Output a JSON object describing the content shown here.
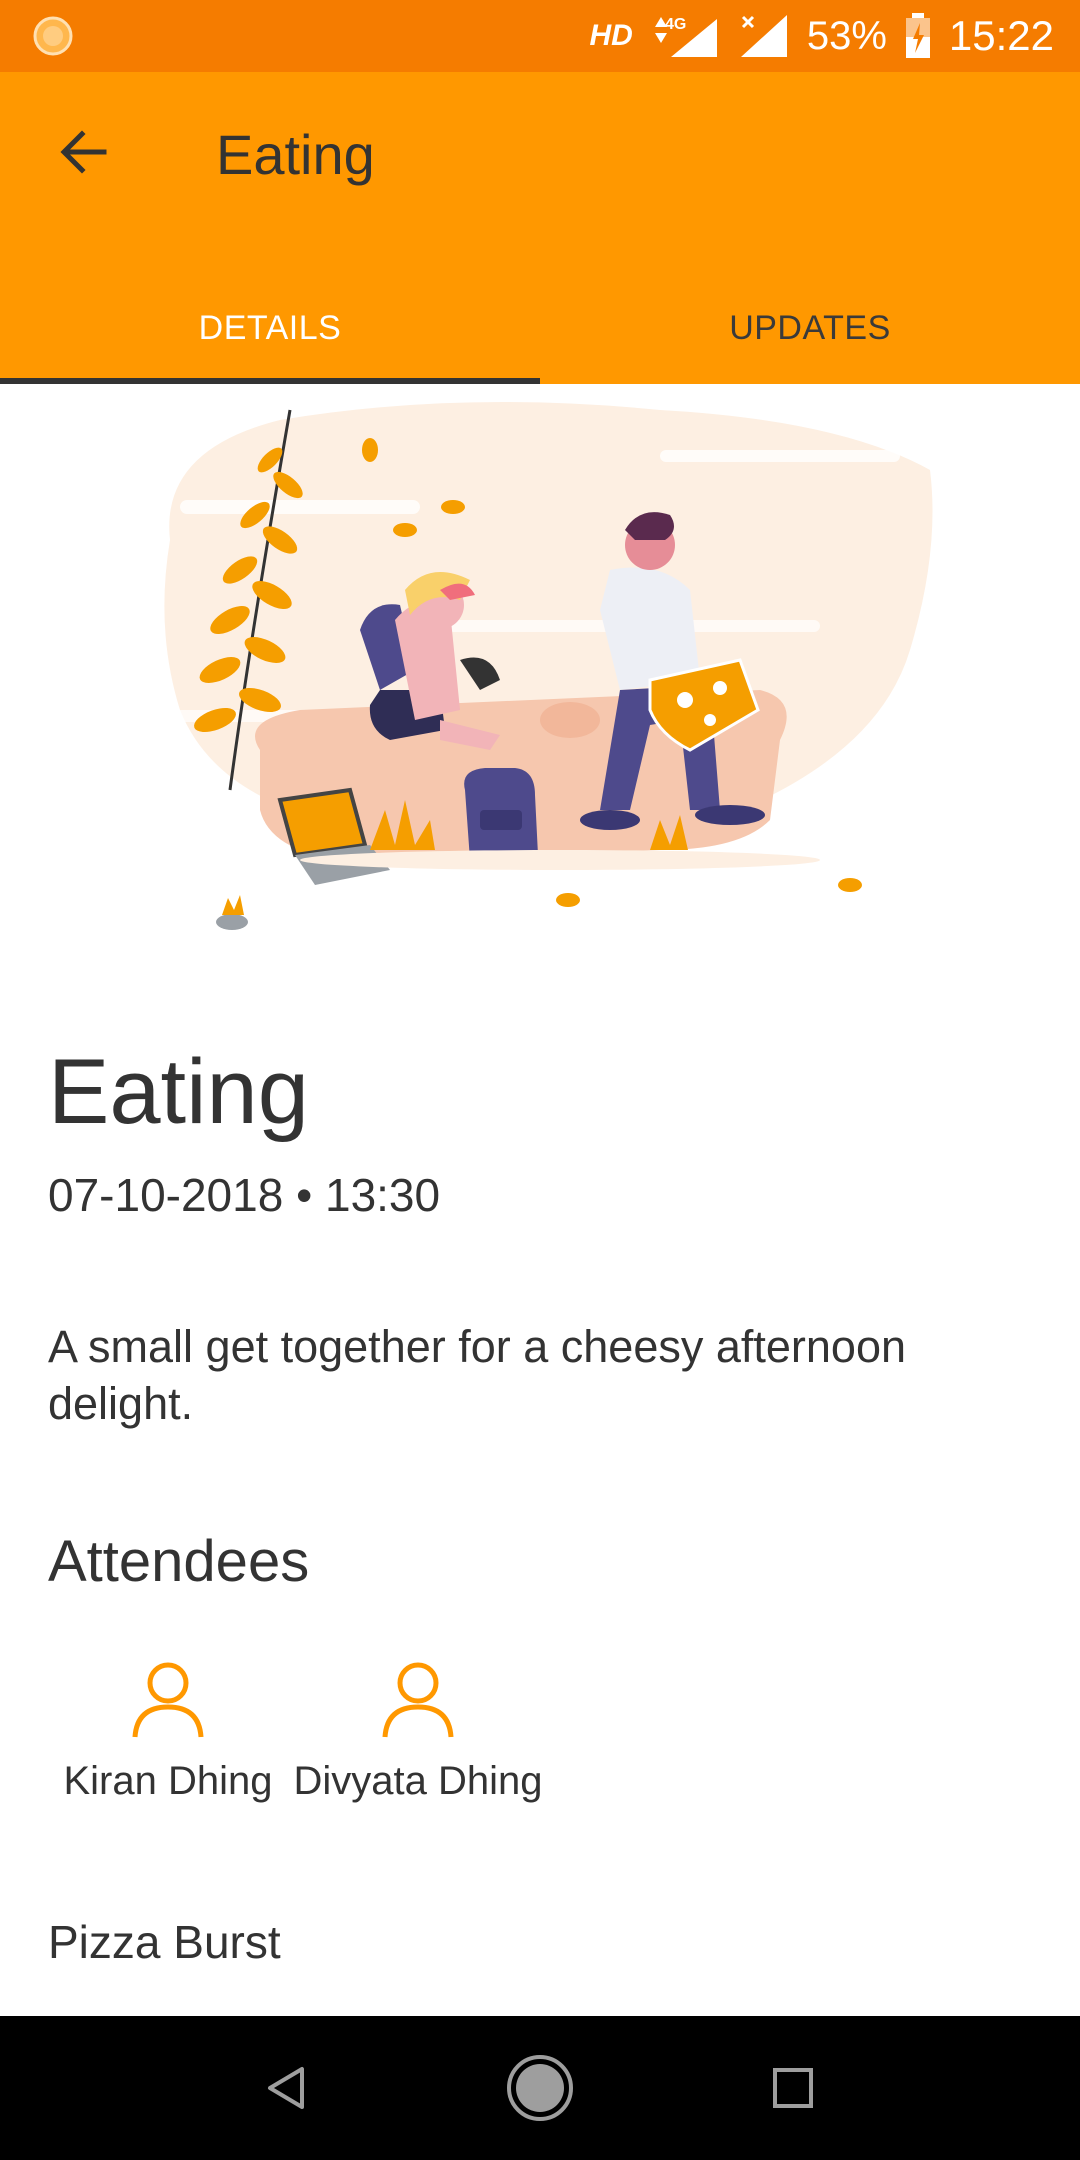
{
  "status_bar": {
    "network": "HD",
    "signal_type": "4G",
    "battery": "53%",
    "time": "15:22"
  },
  "app_bar": {
    "title": "Eating",
    "tabs": [
      {
        "label": "DETAILS",
        "active": true
      },
      {
        "label": "UPDATES",
        "active": false
      }
    ],
    "colors": {
      "primary": "#FF9800",
      "status": "#F57C00",
      "text": "#333333"
    }
  },
  "event": {
    "title": "Eating",
    "date": "07-10-2018",
    "separator": "•",
    "time": "13:30",
    "description": "A small get together for a cheesy afternoon delight.",
    "attendees_heading": "Attendees",
    "attendees": [
      {
        "name": "Kiran Dhing",
        "icon": "person-icon"
      },
      {
        "name": "Divyata Dhing",
        "icon": "person-icon"
      }
    ],
    "venue": "Pizza Burst"
  },
  "nav_bar": {
    "buttons": [
      "back-triangle-icon",
      "home-circle-icon",
      "recents-square-icon"
    ]
  }
}
